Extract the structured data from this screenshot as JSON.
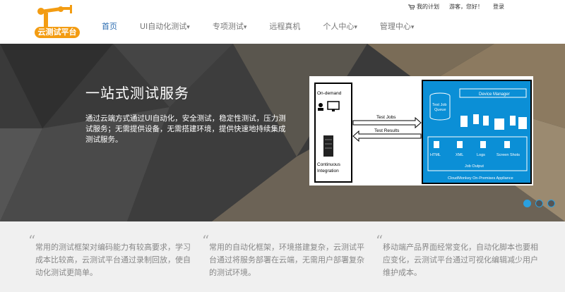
{
  "header": {
    "logo_text": "云测试平台",
    "top_links": {
      "my_plan": "我的计划",
      "greeting": "游客，您好！",
      "login": "登录"
    }
  },
  "nav": {
    "items": [
      {
        "label": "首页",
        "active": true,
        "dropdown": false
      },
      {
        "label": "UI自动化测试",
        "active": false,
        "dropdown": true
      },
      {
        "label": "专项测试",
        "active": false,
        "dropdown": true
      },
      {
        "label": "远程真机",
        "active": false,
        "dropdown": false
      },
      {
        "label": "个人中心",
        "active": false,
        "dropdown": true
      },
      {
        "label": "管理中心",
        "active": false,
        "dropdown": true
      }
    ],
    "accent_color": "#2b6cb0"
  },
  "hero": {
    "title": "一站式测试服务",
    "description": "通过云端方式通过UI自动化，安全测试，稳定性测试，压力测试服务；无需提供设备，无需搭建环境，提供快速地持续集成测试服务。"
  },
  "diagram": {
    "on_demand": "On-demand",
    "continuous": "Continuous",
    "integration": "Integration",
    "test_jobs": "Test Jobs",
    "test_results": "Test Results",
    "test_job_queue_1": "Test Job",
    "test_job_queue_2": "Queue",
    "device_manager": "Device Manager",
    "outputs": [
      "HTML",
      "XML",
      "Logs",
      "Screen Shots"
    ],
    "job_output": "Job Output",
    "appliance": "CloudMonkey On-Premises Appliance"
  },
  "carousel": {
    "slides": 3,
    "active_index": 0
  },
  "features": [
    {
      "text": "常用的测试框架对编码能力有较高要求，学习成本比较高，云测试平台通过录制回放，使自动化测试更简单。"
    },
    {
      "text": "常用的自动化框架，环境搭建复杂，云测试平台通过将服务部署在云端，无需用户部署复杂的测试环境。"
    },
    {
      "text": "移动端产品界面经常变化，自动化脚本也要相应变化，云测试平台通过可视化编辑减少用户维护成本。"
    }
  ]
}
